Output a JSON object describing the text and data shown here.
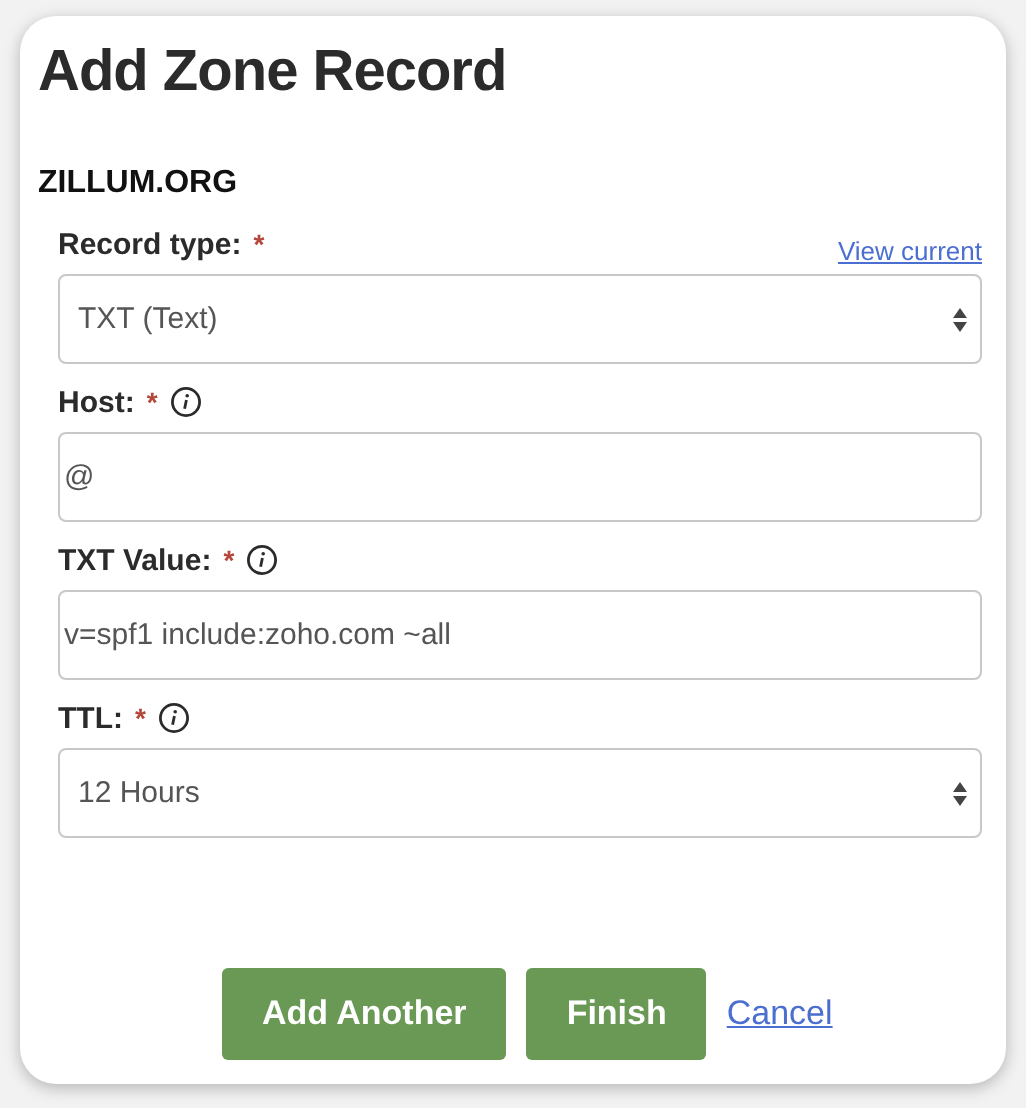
{
  "title": "Add Zone Record",
  "domain": "ZILLUM.ORG",
  "fields": [
    {
      "kind": "select",
      "label": "Record type:",
      "required": "*",
      "info": false,
      "link": "View current",
      "value": "TXT (Text)"
    },
    {
      "kind": "input",
      "label": "Host:",
      "required": "*",
      "info": true,
      "value": "@"
    },
    {
      "kind": "input",
      "label": "TXT Value:",
      "required": "*",
      "info": true,
      "value": "v=spf1 include:zoho.com ~all"
    },
    {
      "kind": "select",
      "label": "TTL:",
      "required": "*",
      "info": true,
      "value": "12 Hours"
    }
  ],
  "buttons": [
    "Add Another",
    "Finish"
  ],
  "cancel": "Cancel"
}
